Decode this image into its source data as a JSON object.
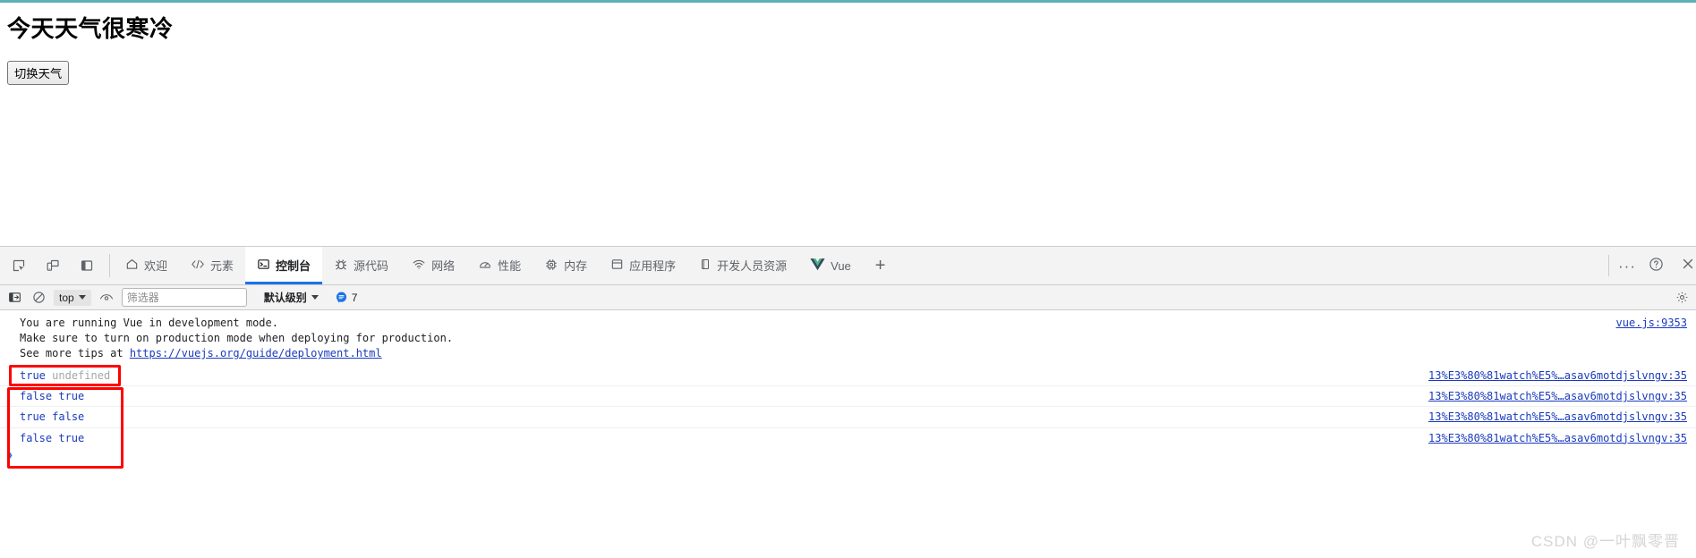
{
  "page": {
    "heading": "今天天气很寒冷",
    "toggle_button_label": "切换天气",
    "accent_top_border": "#5fb0b7"
  },
  "devtools": {
    "left_icons": [
      {
        "name": "inspect-element-icon",
        "label": "检查元素"
      },
      {
        "name": "device-toolbar-icon",
        "label": "切换设备工具栏"
      },
      {
        "name": "dock-side-icon",
        "label": "停靠位置"
      }
    ],
    "tabs": [
      {
        "label": "欢迎",
        "icon": "home-icon",
        "active": false
      },
      {
        "label": "元素",
        "icon": "code-brackets-icon",
        "active": false
      },
      {
        "label": "控制台",
        "icon": "console-terminal-icon",
        "active": true
      },
      {
        "label": "源代码",
        "icon": "bug-icon",
        "active": false
      },
      {
        "label": "网络",
        "icon": "wifi-icon",
        "active": false
      },
      {
        "label": "性能",
        "icon": "gauge-icon",
        "active": false
      },
      {
        "label": "内存",
        "icon": "chip-icon",
        "active": false
      },
      {
        "label": "应用程序",
        "icon": "application-icon",
        "active": false
      },
      {
        "label": "开发人员资源",
        "icon": "book-icon",
        "active": false
      },
      {
        "label": "Vue",
        "icon": "vue-logo-icon",
        "active": false
      }
    ],
    "add_tab_label": "+",
    "more_options_label": "···",
    "help_label": "?",
    "close_label": "×",
    "active_tab_underline_color": "#1a73e8"
  },
  "console_toolbar": {
    "sidebar_toggle_icon": "console-sidebar-icon",
    "clear_console_icon": "clear-console-icon",
    "context_selector_value": "top",
    "live_expression_icon": "eye-icon",
    "filter_placeholder": "筛选器",
    "filter_value": "",
    "level_selector_value": "默认级别",
    "info_count": "7",
    "info_badge_color": "#1a73e8",
    "settings_icon": "gear-icon"
  },
  "console_messages": [
    {
      "type": "vue-warning",
      "lines": [
        "You are running Vue in development mode.",
        "Make sure to turn on production mode when deploying for production.",
        "See more tips at "
      ],
      "link_text": "https://vuejs.org/guide/deployment.html",
      "source": "vue.js:9353"
    },
    {
      "type": "log",
      "tokens": [
        {
          "text": "true",
          "style": "bool"
        },
        {
          "text": "undefined",
          "style": "undef"
        }
      ],
      "source": "13%E3%80%81watch%E5%…asav6motdjslvngv:35"
    },
    {
      "type": "log",
      "tokens": [
        {
          "text": "false",
          "style": "bool"
        },
        {
          "text": "true",
          "style": "bool"
        }
      ],
      "source": "13%E3%80%81watch%E5%…asav6motdjslvngv:35"
    },
    {
      "type": "log",
      "tokens": [
        {
          "text": "true",
          "style": "bool"
        },
        {
          "text": "false",
          "style": "bool"
        }
      ],
      "source": "13%E3%80%81watch%E5%…asav6motdjslvngv:35"
    },
    {
      "type": "log",
      "tokens": [
        {
          "text": "false",
          "style": "bool"
        },
        {
          "text": "true",
          "style": "bool"
        }
      ],
      "source": "13%E3%80%81watch%E5%…asav6motdjslvngv:35"
    }
  ],
  "console_prompt": {
    "caret": "❯",
    "value": ""
  },
  "annotations": {
    "highlight_color": "#fd0000",
    "boxes": [
      {
        "name": "annotation-box-first-log"
      },
      {
        "name": "annotation-box-remaining-logs"
      }
    ]
  },
  "watermark": {
    "text": "CSDN @一叶飘零晋"
  }
}
